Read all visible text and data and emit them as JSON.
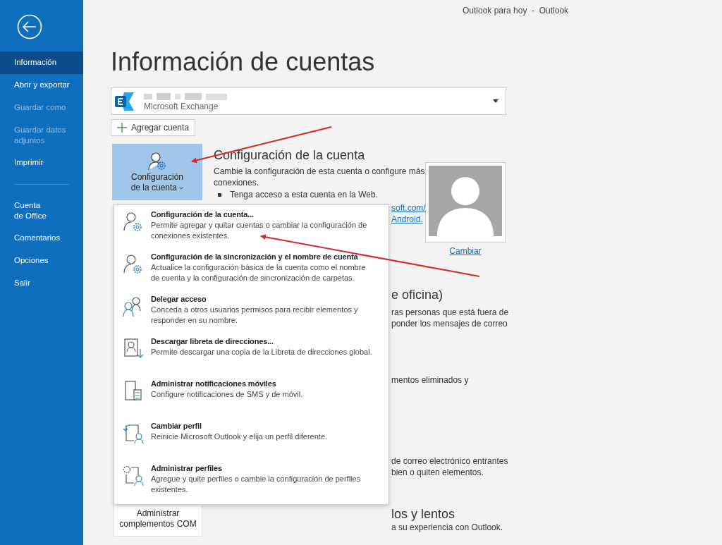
{
  "window": {
    "title": "Outlook para hoy  -  Outlook"
  },
  "sidebar": {
    "groups": [
      [
        {
          "label": "Información",
          "selected": true,
          "disabled": false
        },
        {
          "label": "Abrir y exportar",
          "selected": false,
          "disabled": false
        },
        {
          "label": "Guardar como",
          "selected": false,
          "disabled": true
        },
        {
          "label": "Guardar datos adjuntos",
          "selected": false,
          "disabled": true
        },
        {
          "label": "Imprimir",
          "selected": false,
          "disabled": false
        }
      ],
      [
        {
          "label": "Cuenta\nde Office",
          "selected": false,
          "disabled": false
        },
        {
          "label": "Comentarios",
          "selected": false,
          "disabled": false
        },
        {
          "label": "Opciones",
          "selected": false,
          "disabled": false
        },
        {
          "label": "Salir",
          "selected": false,
          "disabled": false
        }
      ]
    ]
  },
  "page_title": "Información de cuentas",
  "account": {
    "type": "Microsoft Exchange"
  },
  "add_account": "Agregar cuenta",
  "account_settings_button": {
    "label": "Configuración de la cuenta",
    "expanded": true
  },
  "account_section": {
    "heading": "Configuración de la cuenta",
    "description": "Cambie la configuración de esta cuenta o configure más conexiones.",
    "bullet": "Tenga acceso a esta cuenta en la Web.",
    "link_fragments": [
      "soft.com/",
      "Android."
    ],
    "photo_link": "Cambiar"
  },
  "menu": [
    {
      "kind": "account-settings",
      "title": "Configuración de la cuenta...",
      "description": "Permite agregar y quitar cuentas o cambiar la configuración de conexiones existentes."
    },
    {
      "kind": "sync-settings",
      "title": "Configuración de la sincronización y el nombre de cuenta",
      "description": "Actualice la configuración básica de la cuenta como el nombre de cuenta y la configuración de sincronización de carpetas."
    },
    {
      "kind": "delegate",
      "title": "Delegar acceso",
      "description": "Conceda a otros usuarios permisos para recibir elementos y responder en su nombre."
    },
    {
      "kind": "address-book",
      "title": "Descargar libreta de direcciones...",
      "description": "Permite descargar una copia de la Libreta de direcciones global."
    },
    {
      "kind": "mobile",
      "title": "Administrar notificaciones móviles",
      "description": "Configure notificaciones de SMS y de móvil."
    },
    {
      "kind": "change-profile",
      "title": "Cambiar perfil",
      "description": "Reinicie Microsoft Outlook y elija un perfil diferente."
    },
    {
      "kind": "manage-profiles",
      "title": "Administrar perfiles",
      "description": "Agregue y quite perfiles o cambie la configuración de perfiles existentes."
    }
  ],
  "hidden_fragments": [
    {
      "kind": "heading",
      "text": "e oficina)"
    },
    {
      "kind": "line",
      "text": "ras personas que está fuera de"
    },
    {
      "kind": "line",
      "text": "ponder los mensajes de correo"
    },
    {
      "kind": "line",
      "text": "mentos eliminados y"
    },
    {
      "kind": "line",
      "text": "de correo electrónico entrantes"
    },
    {
      "kind": "line",
      "text": "bien o quiten elementos."
    },
    {
      "kind": "heading",
      "text": "los y lentos"
    },
    {
      "kind": "line",
      "text": "a su experiencia con Outlook."
    }
  ],
  "com_addins": {
    "button": "Administrar complementos COM"
  }
}
